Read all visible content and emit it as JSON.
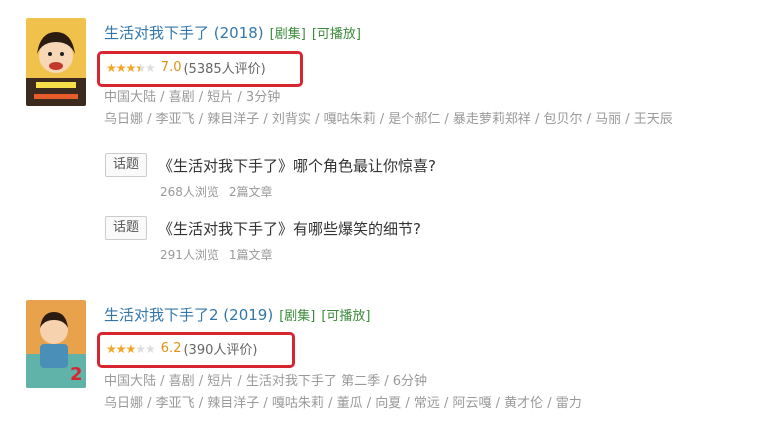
{
  "results": [
    {
      "title": "生活对我下手了 (2018)",
      "tag_series": "[剧集]",
      "tag_play": "[可播放]",
      "rating_score": "7.0",
      "rating_count": "(5385人评价)",
      "rating_stars_fraction": 0.7,
      "meta": "中国大陆 / 喜剧 / 短片 / 3分钟",
      "cast": "乌日娜 / 李亚飞 / 辣目洋子 / 刘背实 / 嘎咕朱莉 / 是个郝仁 / 暴走萝莉郑祥 / 包贝尔 / 马丽 / 王天辰",
      "poster_colors": [
        "#f2c14a",
        "#c96b2a"
      ],
      "topics": [
        {
          "badge": "话题",
          "title": "《生活对我下手了》哪个角色最让你惊喜?",
          "views": "268人浏览",
          "articles": "2篇文章"
        },
        {
          "badge": "话题",
          "title": "《生活对我下手了》有哪些爆笑的细节?",
          "views": "291人浏览",
          "articles": "1篇文章"
        }
      ]
    },
    {
      "title": "生活对我下手了2 (2019)",
      "tag_series": "[剧集]",
      "tag_play": "[可播放]",
      "rating_score": "6.2",
      "rating_count": "(390人评价)",
      "rating_stars_fraction": 0.62,
      "meta": "中国大陆 / 喜剧 / 短片 / 生活对我下手了 第二季 / 6分钟",
      "cast": "乌日娜 / 李亚飞 / 辣目洋子 / 嘎咕朱莉 / 董瓜 / 向夏 / 常远 / 阿云嘎 / 黄才伦 / 雷力",
      "poster_colors": [
        "#e8a04a",
        "#58a9a0"
      ],
      "topics": []
    }
  ],
  "highlight_color": "#d7262f",
  "star_color": "#f5a623"
}
